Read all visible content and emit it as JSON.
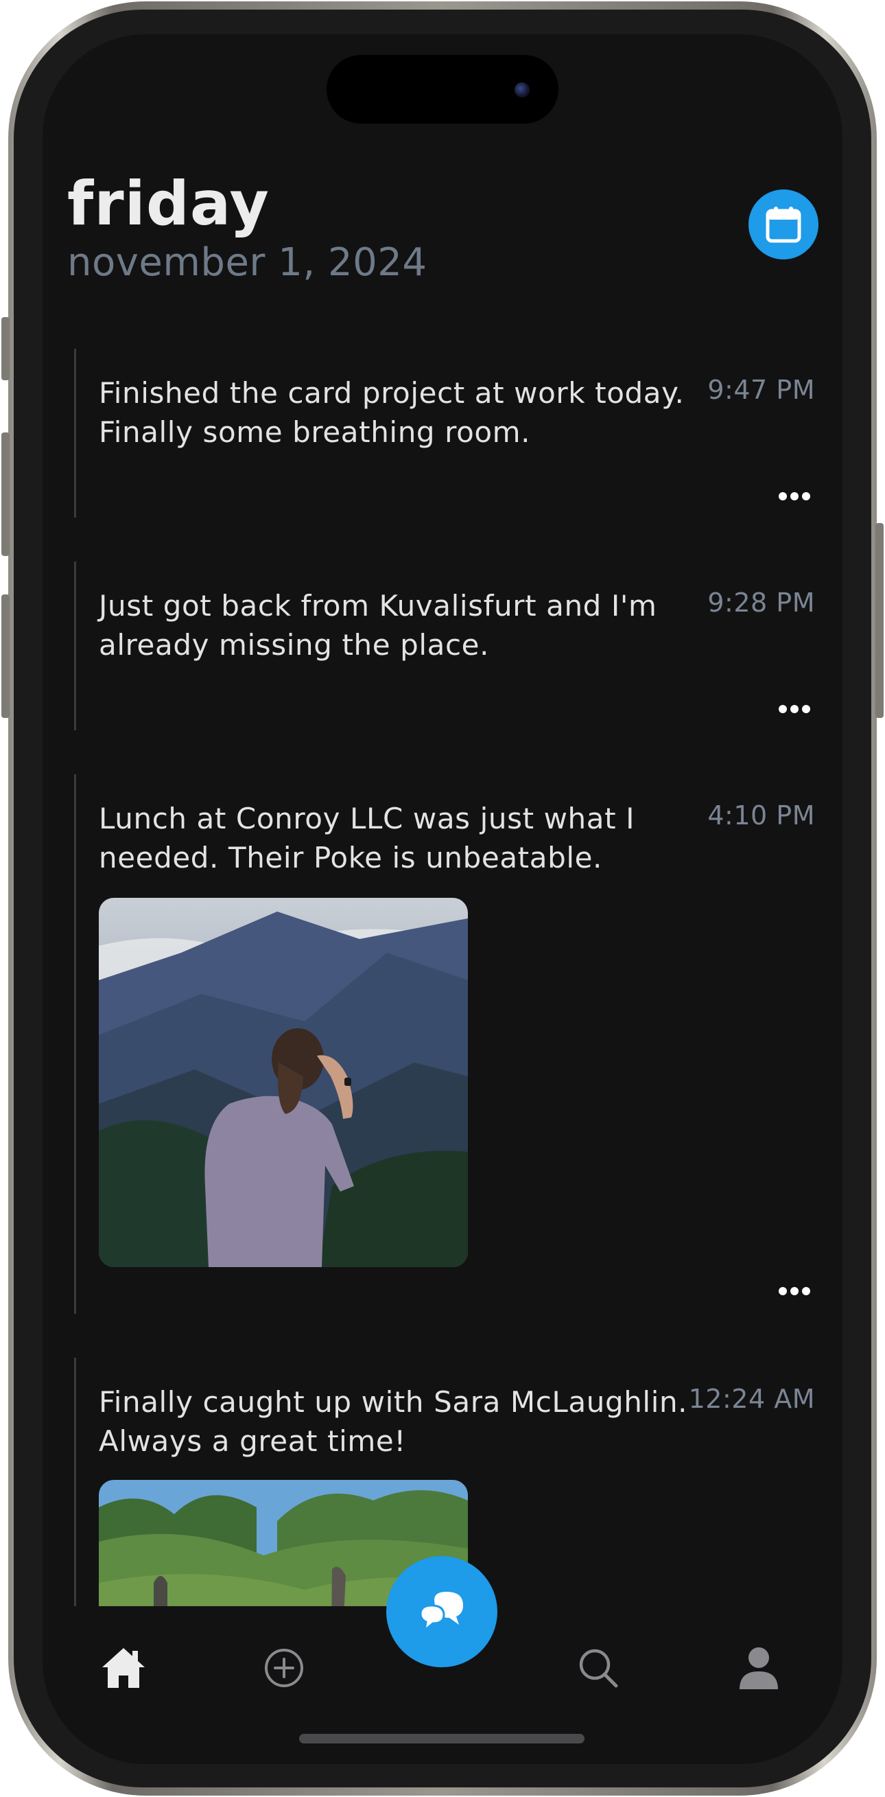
{
  "header": {
    "day": "friday",
    "date": "november 1, 2024"
  },
  "entries": [
    {
      "text": "Finished the card project at work today. Finally some breathing room.",
      "time": "9:47 PM",
      "has_photo": false
    },
    {
      "text": "Just got back from Kuvalisfurt and I'm already missing the place.",
      "time": "9:28 PM",
      "has_photo": false
    },
    {
      "text": "Lunch at Conroy LLC was just what I needed. Their Poke is unbeatable.",
      "time": "4:10 PM",
      "has_photo": true,
      "photo": "mountain-valley-person-photo"
    },
    {
      "text": "Finally caught up with Sara McLaughlin. Always a great time!",
      "time": "12:24 AM",
      "has_photo": true,
      "photo": "forest-trail-photo"
    }
  ],
  "nav": {
    "items": [
      "home-icon",
      "add-circle-icon",
      "chat-bubbles-icon",
      "search-icon",
      "profile-icon"
    ],
    "active": "home-icon"
  },
  "colors": {
    "accent": "#1e9be9",
    "background": "#121213",
    "text": "#e3e3e3",
    "muted": "#6f7a88"
  }
}
